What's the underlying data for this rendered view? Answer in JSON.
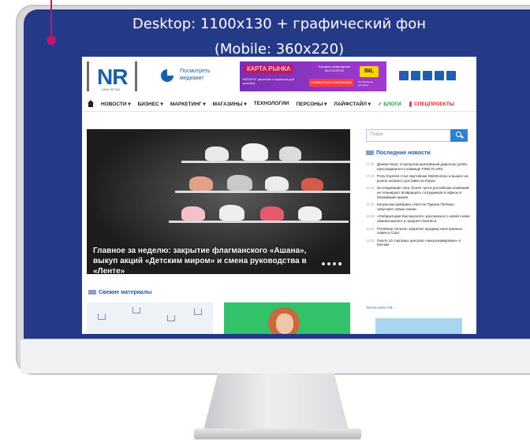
{
  "caption": {
    "line1": "Desktop: 1100x130 + графический фон",
    "line2": "(Mobile: 360x220)"
  },
  "site": {
    "logo": "NR",
    "logo_sub": "NEW RETAIL",
    "watch": "Посмотреть медиакит",
    "banner": {
      "brand": "КАРТА РЫНКА",
      "free_text": "Базовое размещение БЕСПЛАТНО",
      "catalog": "КАТАЛОГ решений и сервисов для ритейла",
      "button": "РАЗМЕСТИТЬ КОМПАНИЮ",
      "partner": "IML",
      "partner_sub": "Оптимальная доставка"
    },
    "socials": [
      "facebook-icon",
      "vk-icon",
      "telegram-icon",
      "ok-icon",
      "mail-icon"
    ],
    "nav": [
      {
        "label": "НОВОСТИ ▾",
        "style": "normal"
      },
      {
        "label": "БИЗНЕС ▾",
        "style": "normal"
      },
      {
        "label": "МАРКЕТИНГ ▾",
        "style": "normal"
      },
      {
        "label": "МАГАЗИНЫ ▾",
        "style": "normal"
      },
      {
        "label": "ТЕХНОЛОГИИ",
        "style": "normal"
      },
      {
        "label": "ПЕРСОНЫ ▾",
        "style": "normal"
      },
      {
        "label": "ЛАЙФСТАЙЛ ▾",
        "style": "normal"
      },
      {
        "label": "✓ БЛОГИ",
        "style": "green"
      },
      {
        "label": "❚ СПЕЦПРОЕКТЫ",
        "style": "red"
      }
    ],
    "hero_caption": "Главное за неделю: закрытие флагманского «Ашана», выкуп акций «Детским миром» и смена руководства в «Ленте»",
    "fresh_title": "Свежие материалы",
    "search_placeholder": "Поиск",
    "news_title": "Последние новости",
    "news": [
      {
        "time": "17:30",
        "text": "Даниел Берт, в прошлом креативный директор ЦУМа, присоединился к команде FINN FLARE"
      },
      {
        "time": "17:10",
        "text": "Pony Express стал партнёром StyleKorean и вышел на рынок экспресс-доставки из Кореи"
      },
      {
        "time": "16:45",
        "text": "Исследование Visa: более трети российских компаний не планируют возвращать сотрудников в офисы в ближайшие время"
      },
      {
        "time": "16:20",
        "text": "Калужская фабрика «Нестле Пурина ПетКер» запускает новые линии"
      },
      {
        "time": "15:50",
        "text": "«Лаборатория Касперского» рассказала о новой схеме обмана малого и среднего бизнеса"
      },
      {
        "time": "15:20",
        "text": "Ритейлер Amazon запретил продажу иностранных семян в США"
      },
      {
        "time": "14:55",
        "text": "Около 10 торговых центров «законсервирован» в Москве"
      }
    ],
    "news_more": "Лента новостей →"
  },
  "colors": {
    "screen_bg": "#253a86",
    "accent": "#1a5fa8",
    "marker": "#c0156e"
  }
}
